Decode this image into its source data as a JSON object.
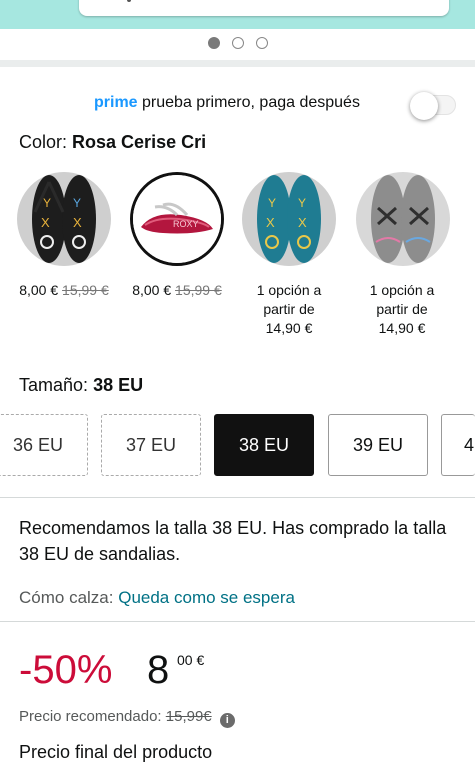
{
  "carousel": {
    "page_count": 3,
    "active_index": 0
  },
  "prime": {
    "brand": "prime",
    "text": "prueba primero, paga después",
    "toggle_on": false
  },
  "color": {
    "label": "Color:",
    "value": "Rosa Cerise Cri"
  },
  "swatches": [
    {
      "name": "Negro",
      "price": "8,00 €",
      "old_price": "15,99 €",
      "selected": false
    },
    {
      "name": "Rosa Cerise Cri",
      "price": "8,00 €",
      "old_price": "15,99 €",
      "selected": true
    },
    {
      "name": "Azul",
      "line1": "1 opción a",
      "line2": "partir de",
      "line3": "14,90 €",
      "selected": false
    },
    {
      "name": "Gris",
      "line1": "1 opción a",
      "line2": "partir de",
      "line3": "14,90 €",
      "selected": false
    }
  ],
  "size": {
    "label": "Tamaño:",
    "value": "38 EU",
    "options": [
      "36 EU",
      "37 EU",
      "38 EU",
      "39 EU",
      "4"
    ]
  },
  "recommendation": "Recomendamos la talla 38 EU. Has comprado la talla 38 EU de sandalias.",
  "fit": {
    "label": "Cómo calza:",
    "value": "Queda como se espera"
  },
  "price": {
    "discount": "-50%",
    "whole": "8",
    "fraction": "00 €",
    "recommended_label": "Precio recomendado:",
    "recommended_value": "15,99€",
    "info_icon": "info-icon"
  },
  "final_price_label": "Precio final del producto",
  "colors": {
    "prime_blue": "#1a98ff",
    "discount_red": "#cc0c39",
    "link_teal": "#007185",
    "header_teal": "#a6e7e0"
  }
}
